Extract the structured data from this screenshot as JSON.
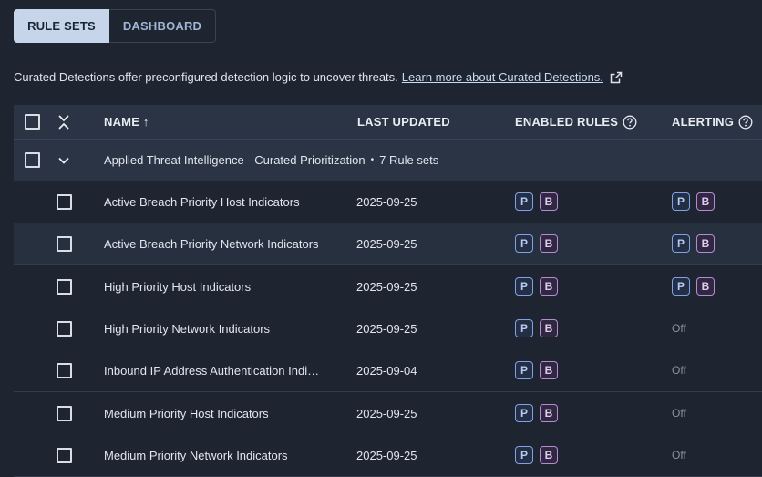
{
  "tabs": [
    {
      "label": "RULE SETS",
      "active": true
    },
    {
      "label": "DASHBOARD",
      "active": false
    }
  ],
  "intro": {
    "text": "Curated Detections offer preconfigured detection logic to uncover threats.",
    "link": "Learn more about Curated Detections."
  },
  "columns": {
    "name": "NAME ↑",
    "last_updated": "LAST UPDATED",
    "enabled_rules": "ENABLED RULES",
    "alerting": "ALERTING"
  },
  "group": {
    "name": "Applied Threat Intelligence - Curated Prioritization",
    "separator": "•",
    "count": "7 Rule sets"
  },
  "badges": {
    "p": "P",
    "b": "B"
  },
  "rows": [
    {
      "name": "Active Breach Priority Host Indicators",
      "updated": "2025-09-25",
      "alerting": "",
      "alerting_on": true
    },
    {
      "name": "Active Breach Priority Network Indicators",
      "updated": "2025-09-25",
      "alerting": "",
      "alerting_on": true
    },
    {
      "name": "High Priority Host Indicators",
      "updated": "2025-09-25",
      "alerting": "",
      "alerting_on": true
    },
    {
      "name": "High Priority Network Indicators",
      "updated": "2025-09-25",
      "alerting": "Off",
      "alerting_on": false
    },
    {
      "name": "Inbound IP Address Authentication Indi…",
      "updated": "2025-09-04",
      "alerting": "Off",
      "alerting_on": false
    },
    {
      "name": "Medium Priority Host Indicators",
      "updated": "2025-09-25",
      "alerting": "Off",
      "alerting_on": false
    },
    {
      "name": "Medium Priority Network Indicators",
      "updated": "2025-09-25",
      "alerting": "Off",
      "alerting_on": false
    }
  ],
  "colors": {
    "background": "#1e2430",
    "header": "#2b3444",
    "badge_p": "#7fa2e6",
    "badge_b": "#b78ad6"
  }
}
